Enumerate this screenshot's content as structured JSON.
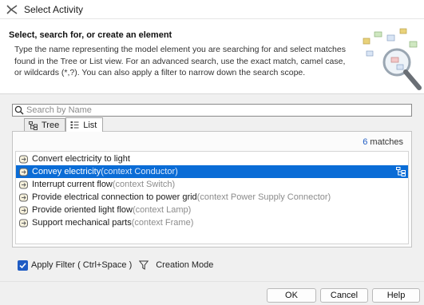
{
  "window": {
    "title": "Select Activity"
  },
  "header": {
    "heading": "Select, search for, or create an element",
    "description": "Type the name representing the model element you are searching for and select matches found in the Tree or List view. For an advanced search, use the exact match, camel case, or wildcards (*,?). You can also apply a filter to narrow down the search scope."
  },
  "search": {
    "placeholder": "Search by Name",
    "value": ""
  },
  "tabs": [
    {
      "label": "Tree",
      "icon": "tree-icon",
      "active": false
    },
    {
      "label": "List",
      "icon": "list-icon",
      "active": true
    }
  ],
  "results": {
    "count": "6",
    "count_suffix": " matches",
    "items": [
      {
        "name": "Convert electricity to light",
        "context": "",
        "selected": false
      },
      {
        "name": "Convey electricity",
        "context": "(context Conductor)",
        "selected": true
      },
      {
        "name": "Interrupt current flow",
        "context": "(context Switch)",
        "selected": false
      },
      {
        "name": "Provide electrical connection to power grid",
        "context": "(context Power Supply Connector)",
        "selected": false
      },
      {
        "name": "Provide oriented light flow",
        "context": "(context Lamp)",
        "selected": false
      },
      {
        "name": "Support mechanical parts",
        "context": "(context Frame)",
        "selected": false
      }
    ]
  },
  "filter": {
    "apply_label": "Apply Filter ( Ctrl+Space )",
    "checked": true,
    "creation_mode_label": "Creation Mode"
  },
  "buttons": {
    "ok": "OK",
    "cancel": "Cancel",
    "help": "Help"
  },
  "colors": {
    "selection": "#0a6cd6",
    "accent": "#1f5cc4",
    "context_text": "#8c8c8c"
  }
}
